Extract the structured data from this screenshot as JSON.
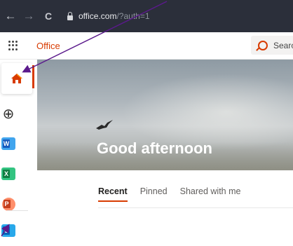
{
  "browser": {
    "url_host": "office.com",
    "url_path": "/?auth=1",
    "nav_glyphs": {
      "back": "←",
      "forward": "→",
      "reload": "C"
    }
  },
  "header": {
    "app_name": "Office",
    "search_placeholder": "Searc"
  },
  "rail": {
    "items": [
      {
        "name": "home",
        "icon": "home-icon"
      },
      {
        "name": "create",
        "icon": "plus-circle-icon",
        "glyph": "⊕"
      },
      {
        "name": "word",
        "icon": "word-icon",
        "letter": "W",
        "color": "#2b579a"
      },
      {
        "name": "excel",
        "icon": "excel-icon",
        "letter": "X",
        "color": "#217346"
      },
      {
        "name": "powerpoint",
        "icon": "powerpoint-icon",
        "letter": "P",
        "color": "#d24726"
      },
      {
        "name": "outlook",
        "icon": "outlook-icon",
        "letter": "O",
        "color": "#0078d4"
      }
    ]
  },
  "hero": {
    "greeting": "Good afternoon"
  },
  "tabs": [
    {
      "label": "Recent",
      "active": true
    },
    {
      "label": "Pinned",
      "active": false
    },
    {
      "label": "Shared with me",
      "active": false
    }
  ],
  "colors": {
    "accent": "#d83b01",
    "annotation_arrow": "#5b1a8c"
  }
}
